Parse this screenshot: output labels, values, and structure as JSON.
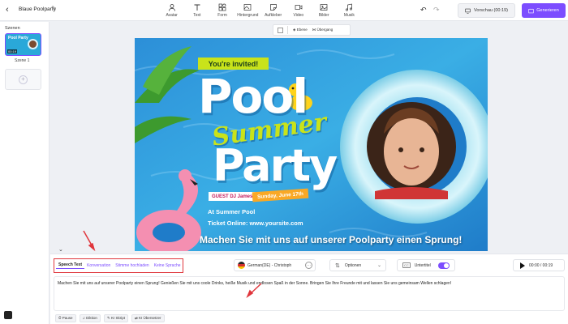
{
  "header": {
    "back_icon": "chevron-left-icon",
    "project_title": "Blaue Poolparty",
    "tools": [
      {
        "label": "Avatar",
        "icon": "avatar-icon"
      },
      {
        "label": "Text",
        "icon": "text-icon"
      },
      {
        "label": "Form",
        "icon": "shape-icon"
      },
      {
        "label": "Hintergrund",
        "icon": "background-icon"
      },
      {
        "label": "Aufkleber",
        "icon": "sticker-icon"
      },
      {
        "label": "Video",
        "icon": "video-icon"
      },
      {
        "label": "Bilder",
        "icon": "image-icon"
      },
      {
        "label": "Musik",
        "icon": "music-icon"
      }
    ],
    "preview_label": "Vorschau (00:19)",
    "generate_label": "Generieren",
    "accent_color": "#7c4dff"
  },
  "sidebar": {
    "heading": "Szenen",
    "scene": {
      "time": "00:19",
      "label": "Szene 1",
      "thumb_text": "Pool Party"
    }
  },
  "canvas_toolbar": {
    "layer_label": "Ebene",
    "transition_label": "Übergang"
  },
  "canvas": {
    "invite": "You're invited!",
    "pool": "Pool",
    "summer": "Summer",
    "party": "Party",
    "guest": "GUEST DJ James",
    "date": "Sunday, June 17th",
    "location": "At Summer Pool",
    "ticket": "Ticket Online: www.yoursite.com",
    "subtitle": "Machen Sie mit uns auf unserer Poolparty einen Sprung!"
  },
  "bottom": {
    "tabs": [
      "Speech Text",
      "Konversation",
      "Stimme hochladen",
      "Keine Sprache"
    ],
    "active_tab": "Speech Text",
    "voice": "German(DE) - Christoph",
    "options_label": "Optionen",
    "subtitle_label": "Untertitel",
    "subtitle_enabled": true,
    "play_time": "00:00 / 00:19",
    "script_text": "Machen Sie mit uns auf unserer Poolparty einen Sprung! Genießen Sie mit uns coole Drinks, heiße Musik und endlosen Spaß in der Sonne. Bringen Sie Ihre Freunde mit und lassen Sie uns gemeinsam Wellen schlagen!",
    "footer_buttons": [
      "Pause",
      "Diktion",
      "KI Skript",
      "KI Übersetzer"
    ]
  }
}
